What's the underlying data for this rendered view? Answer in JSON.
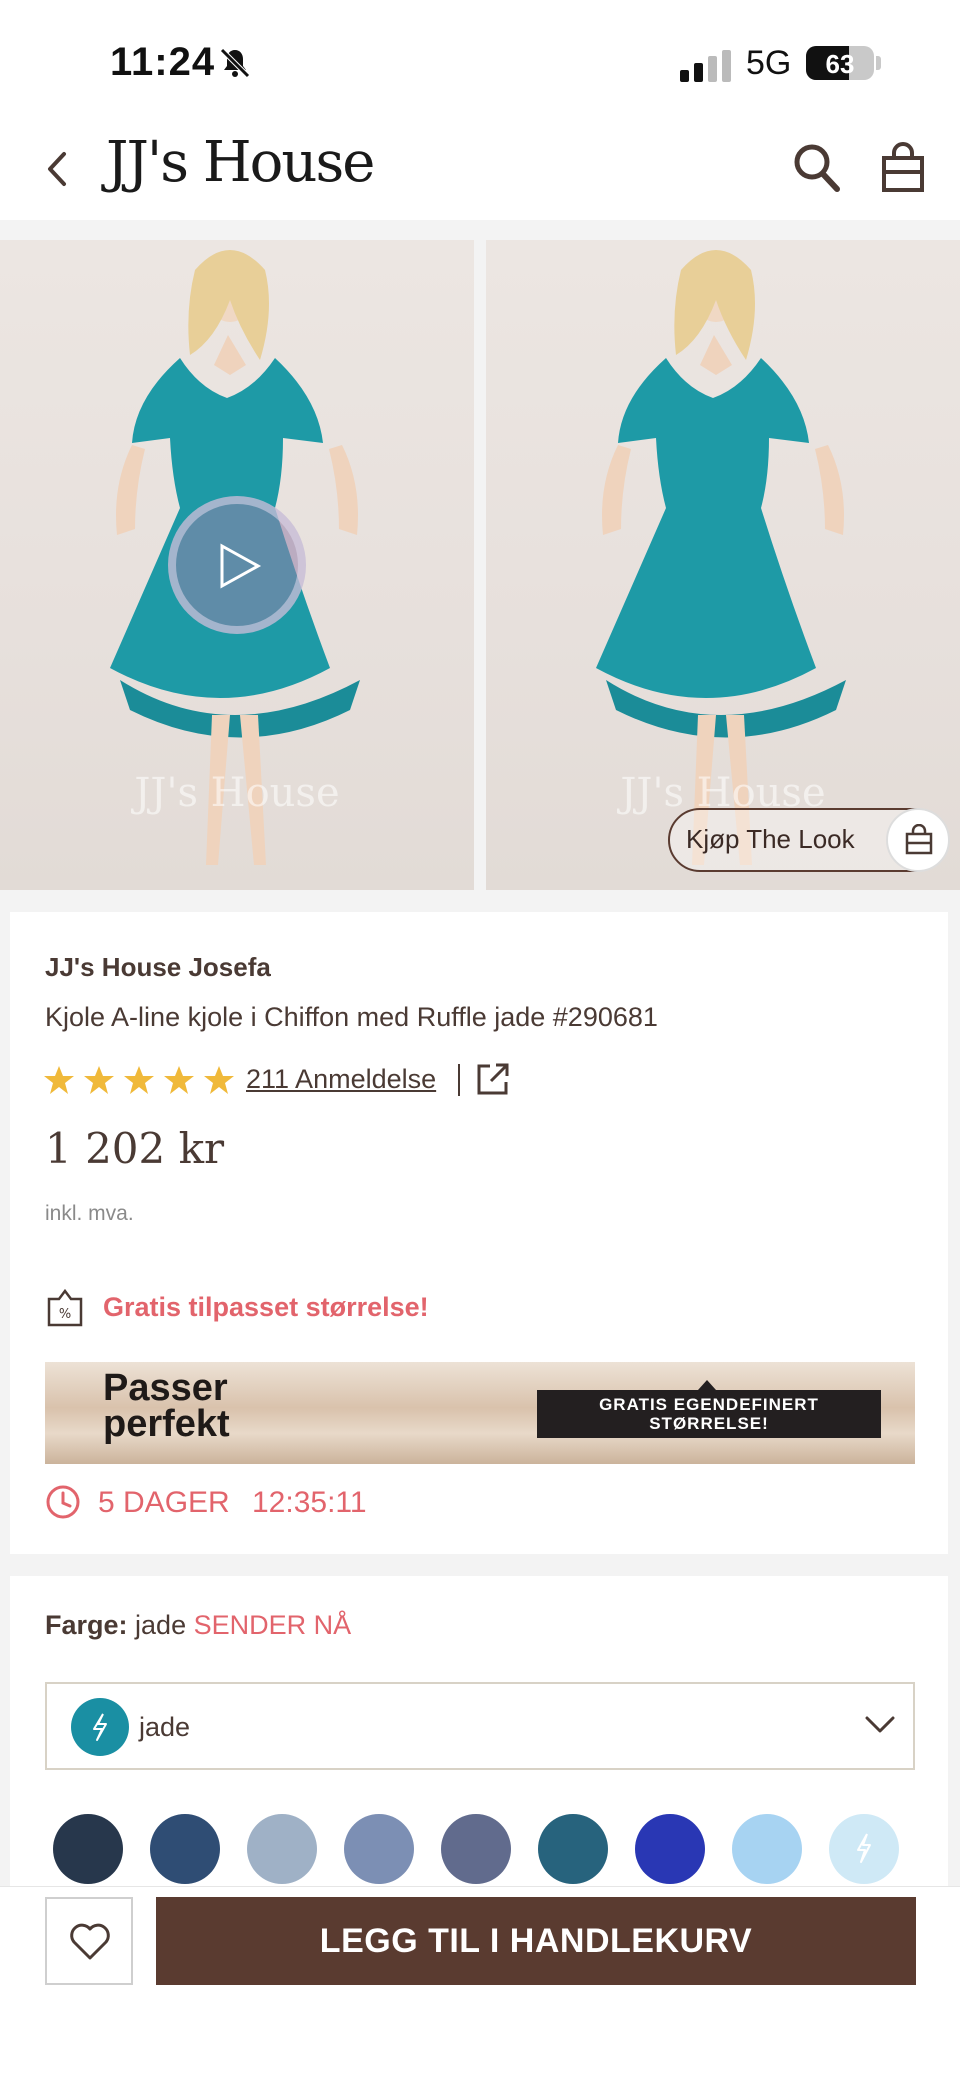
{
  "status_bar": {
    "time": "11:24",
    "network": "5G",
    "battery_level": "63",
    "battery_fraction": 0.63,
    "icons": [
      "bell-slash-icon",
      "signal-icon"
    ]
  },
  "header": {
    "brand": "JJ's House",
    "icons": [
      "chevron-left-icon",
      "search-icon",
      "shopping-bag-icon"
    ]
  },
  "gallery": {
    "watermark": "JJ's House",
    "shop_the_look_label": "Kjøp The Look",
    "photo_count": 2,
    "dress_color": "#1e9aa6"
  },
  "product": {
    "brand": "JJ's House Josefa",
    "title": "Kjole A-line kjole i Chiffon med Ruffle jade #290681",
    "rating": 5,
    "review_link": "211 Anmeldelse",
    "price": "1 202 kr",
    "vat_note": "inkl. mva.",
    "promo_text": "Gratis tilpasset størrelse!",
    "banner": {
      "headline_line1": "Passer",
      "headline_line2": "perfekt",
      "badge_line1": "GRATIS EGENDEFINERT",
      "badge_line2": "STØRRELSE!"
    },
    "countdown": {
      "days": "5 DAGER",
      "time": "12:35:11"
    }
  },
  "color_selector": {
    "label": "Farge:",
    "value": "jade",
    "shipping_note": "SENDER NÅ",
    "selected": "jade",
    "selected_color": "#1a8fa3",
    "swatches": [
      "#27374c",
      "#2f4d74",
      "#9fb1c6",
      "#7c8fb4",
      "#616b8d",
      "#27637d",
      "#2937b4",
      "#a7d3f2",
      "#cfe9f6"
    ]
  },
  "bottom_bar": {
    "add_to_cart_label": "LEGG TIL I HANDLEKURV"
  },
  "colors": {
    "brand_brown": "#5a3b30",
    "accent_coral": "#e2646c",
    "star_gold": "#f0b93a"
  }
}
